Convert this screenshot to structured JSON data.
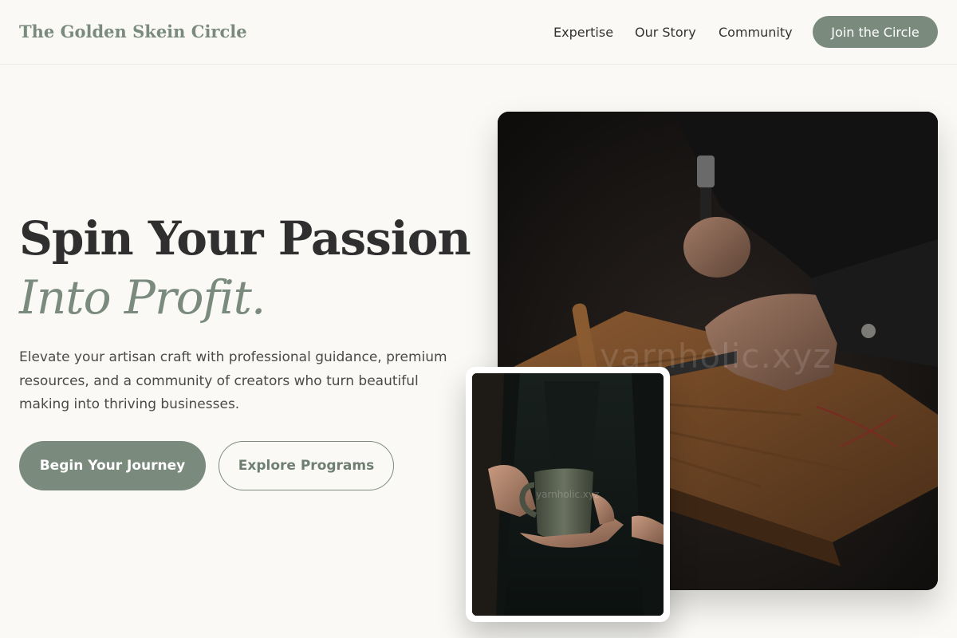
{
  "header": {
    "logo": "The Golden Skein Circle",
    "nav": [
      "Expertise",
      "Our Story",
      "Community"
    ],
    "cta": "Join the Circle"
  },
  "hero": {
    "title_line1": "Spin Your Passion",
    "title_line2": "Into Profit.",
    "description": "Elevate your artisan craft with professional guidance, premium resources, and a community of creators who turn beautiful making into thriving businesses.",
    "primary_button": "Begin Your Journey",
    "secondary_button": "Explore Programs"
  },
  "images": {
    "watermark": "yarnholic.xyz"
  },
  "colors": {
    "accent": "#7a8b7e",
    "background": "#faf9f5",
    "text": "#2f2f2f"
  }
}
